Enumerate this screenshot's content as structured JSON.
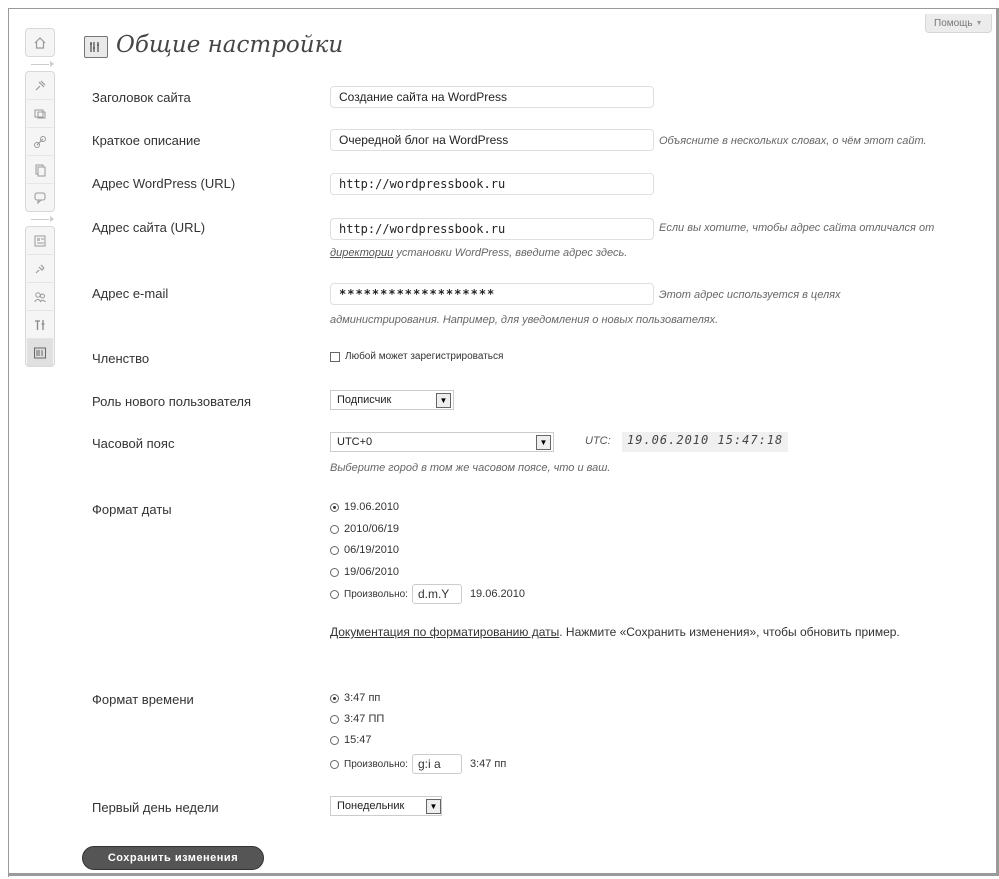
{
  "help": {
    "label": "Помощь",
    "icon": "dropdown-triangle-icon"
  },
  "page": {
    "title": "Общие настройки",
    "icon": "settings-icon"
  },
  "sidebar": {
    "items": [
      {
        "icon": "home-icon"
      },
      {
        "icon": "pin-icon"
      },
      {
        "icon": "media-icon"
      },
      {
        "icon": "link-icon"
      },
      {
        "icon": "pages-icon"
      },
      {
        "icon": "comments-icon"
      },
      {
        "icon": "appearance-icon"
      },
      {
        "icon": "plugins-icon"
      },
      {
        "icon": "users-icon"
      },
      {
        "icon": "tools-icon"
      },
      {
        "icon": "settings-icon"
      }
    ]
  },
  "fields": {
    "site_title": {
      "label": "Заголовок сайта",
      "value": "Создание сайта на WordPress"
    },
    "tagline": {
      "label": "Краткое описание",
      "value": "Очередной блог на WordPress",
      "hint": "Объясните в нескольких словах, о чём этот сайт."
    },
    "wp_url": {
      "label": "Адрес WordPress (URL)",
      "value": "http://wordpressbook.ru"
    },
    "site_url": {
      "label": "Адрес сайта (URL)",
      "value": "http://wordpressbook.ru",
      "hint_part1": "Если вы хотите, чтобы адрес сайта отличался от",
      "hint_link": "директории",
      "hint_part2": " установки WordPress, введите адрес здесь."
    },
    "email": {
      "label": "Адрес e-mail",
      "value": "*******************",
      "hint_line1": "Этот адрес используется в целях",
      "hint_line2": "администрирования. Например, для уведомления о новых пользователях."
    },
    "membership": {
      "label": "Членство",
      "checkbox_label": "Любой может зарегистрироваться",
      "checked": false
    },
    "default_role": {
      "label": "Роль нового пользователя",
      "value": "Подписчик"
    },
    "timezone": {
      "label": "Часовой пояс",
      "value": "UTC+0",
      "utc_label": "UTC:",
      "utc_time": "19.06.2010 15:47:18",
      "hint": "Выберите город в том же часовом поясе, что и ваш."
    },
    "date_format": {
      "label": "Формат даты",
      "options": [
        "19.06.2010",
        "2010/06/19",
        "06/19/2010",
        "19/06/2010"
      ],
      "selected_index": 0,
      "custom_label": "Произвольно:",
      "custom_value": "d.m.Y",
      "custom_preview": "19.06.2010",
      "doc_link": "Документация по форматированию даты",
      "doc_text": ". Нажмите «Сохранить изменения», чтобы обновить пример."
    },
    "time_format": {
      "label": "Формат времени",
      "options": [
        "3:47 пп",
        "3:47 ПП",
        "15:47"
      ],
      "selected_index": 0,
      "custom_label": "Произвольно:",
      "custom_value": "g:i a",
      "custom_preview": "3:47 пп"
    },
    "week_start": {
      "label": "Первый день недели",
      "value": "Понедельник"
    }
  },
  "save_button": "Сохранить изменения"
}
